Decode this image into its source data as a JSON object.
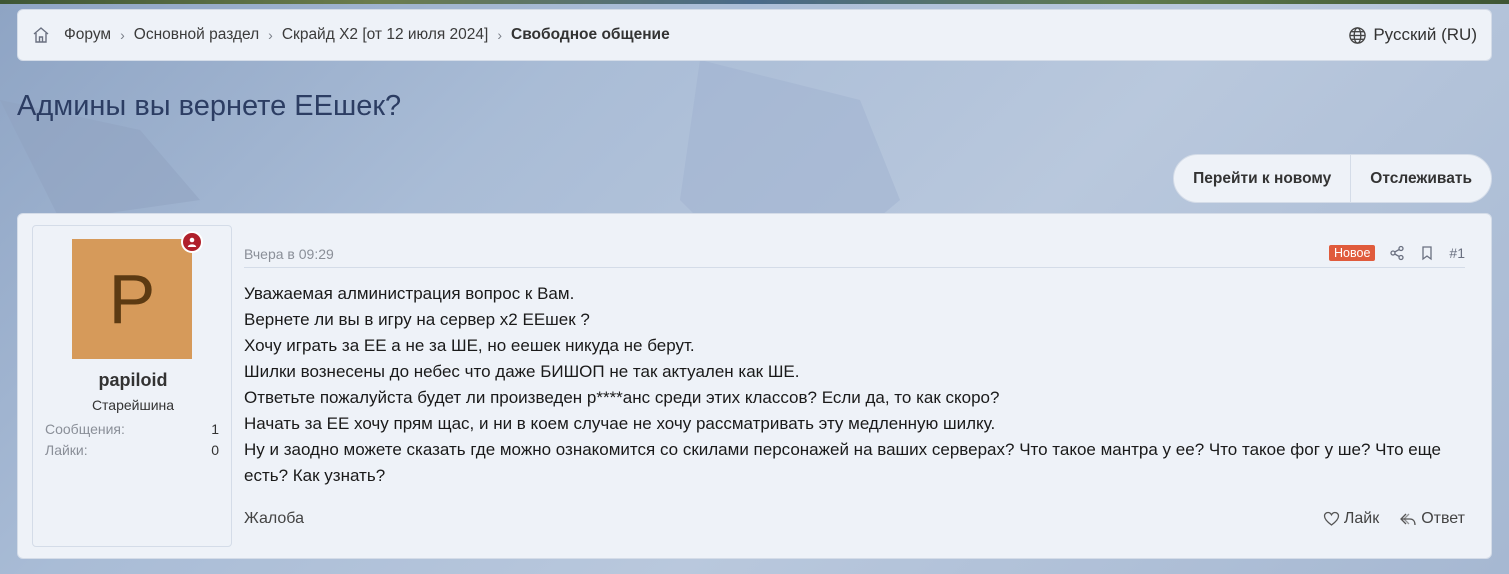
{
  "breadcrumb": {
    "items": [
      "Форум",
      "Основной раздел",
      "Скрайд X2 [от 12 июля 2024]"
    ],
    "current": "Свободное общение",
    "home_icon": "home-icon"
  },
  "language": {
    "label": "Русский (RU)",
    "icon": "globe-icon"
  },
  "thread": {
    "title": "Админы вы вернете ЕЕшек?"
  },
  "actions": {
    "goto_new": "Перейти к новому",
    "watch": "Отслеживать"
  },
  "post": {
    "author": {
      "username": "papiloid",
      "avatar_letter": "P",
      "title": "Старейшина",
      "stats": [
        {
          "label": "Сообщения:",
          "value": "1"
        },
        {
          "label": "Лайки:",
          "value": "0"
        }
      ]
    },
    "date": "Вчера в 09:29",
    "badge_new": "Новое",
    "number": "#1",
    "body": [
      "Уважаемая алминистрация вопрос к Вам.",
      "Вернете ли вы в игру на сервер x2 ЕЕшек ?",
      "Хочу играть за ЕЕ а не за ШЕ, но еешек никуда не берут.",
      "Шилки вознесены до небес что даже БИШОП не так актуален как ШЕ.",
      "Ответьте пожалуйста будет ли произведен р****анс среди этих классов? Если да, то как скоро?",
      "Начать за ЕЕ хочу прям щас, и ни в коем случае не хочу рассматривать эту медленную шилку.",
      "Ну и заодно можете сказать где можно ознакомится со скилами персонажей на ваших серверах? Что такое мантра у ее? Что такое фог у ше? Что еще есть? Как узнать?"
    ],
    "report": "Жалоба",
    "like": "Лайк",
    "reply": "Ответ"
  },
  "colors": {
    "accent_title": "#2c3d63",
    "badge_new": "#e05b3c",
    "avatar_bg": "#d69a5a",
    "online_badge": "#b0202b"
  }
}
